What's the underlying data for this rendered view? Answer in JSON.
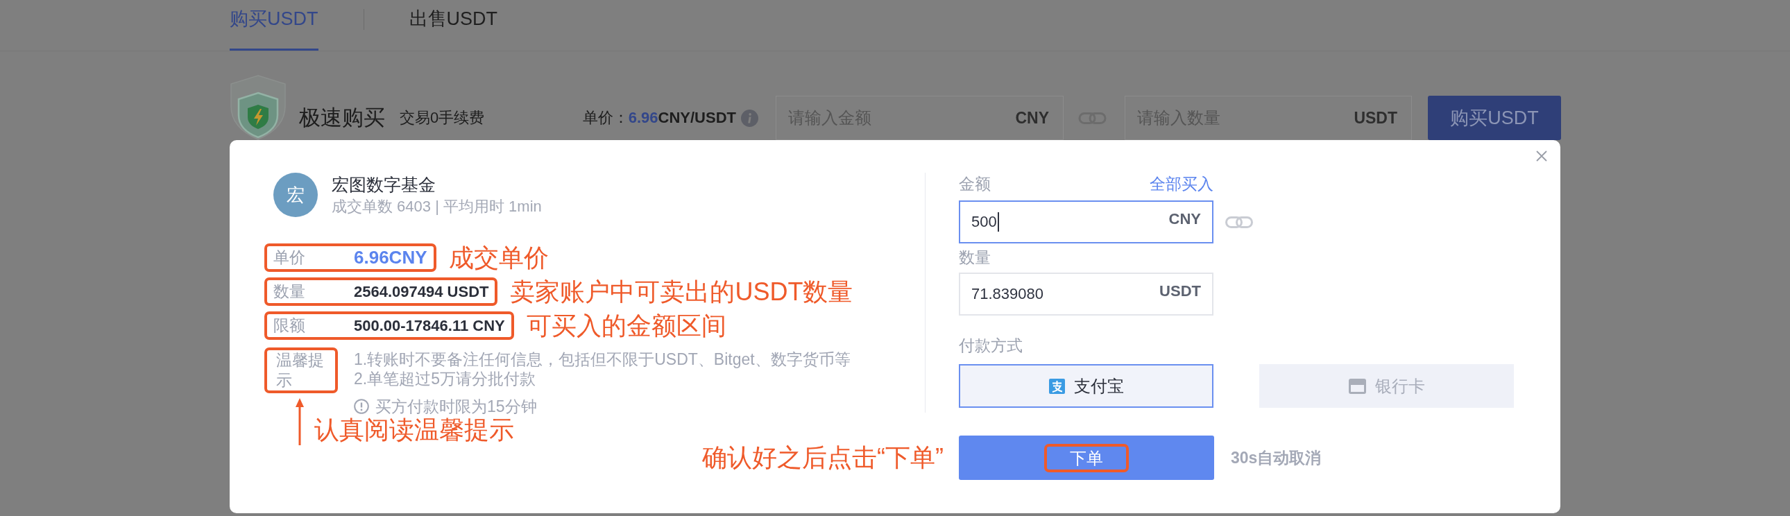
{
  "tabs": [
    {
      "label": "购买USDT",
      "selected": true
    },
    {
      "label": "出售USDT",
      "selected": false
    }
  ],
  "quick_buy": {
    "title": "极速购买",
    "subtitle": "交易0手续费",
    "price_label": "单价：",
    "price_value": "6.96",
    "price_unit": "CNY/USDT",
    "amount_field": {
      "placeholder": "请输入金额",
      "suffix": "CNY"
    },
    "quantity_field": {
      "placeholder": "请输入数量",
      "suffix": "USDT"
    },
    "button": "购买USDT"
  },
  "dialog": {
    "merchant": {
      "avatar": "宏",
      "name": "宏图数字基金",
      "stats": "成交单数 6403 | 平均用时 1min"
    },
    "details": [
      {
        "label": "单价",
        "value": "6.96CNY",
        "kind": "price",
        "highlighted": true,
        "note": "成交单价"
      },
      {
        "label": "数量",
        "value": "2564.097494 USDT",
        "kind": "amount",
        "highlighted": true,
        "note": "卖家账户中可卖出的USDT数量"
      },
      {
        "label": "限额",
        "value": "500.00-17846.11 CNY",
        "kind": "amount",
        "highlighted": true,
        "note": "可买入的金额区间"
      }
    ],
    "tips": {
      "label": "温馨提示",
      "highlighted": true,
      "note": "认真阅读温馨提示",
      "lines": [
        "1.转账时不要备注任何信息，包括但不限于USDT、Bitget、数字货币等",
        "2.单笔超过5万请分批付款"
      ],
      "notice": "买方付款时限为15分钟"
    },
    "form": {
      "amount": {
        "label": "金额",
        "action": "全部买入",
        "value": "500",
        "suffix": "CNY",
        "focused": true
      },
      "quantity": {
        "label": "数量",
        "value": "71.839080",
        "suffix": "USDT",
        "focused": false
      },
      "payment": {
        "label": "付款方式",
        "methods": [
          {
            "label": "支付宝",
            "kind": "alipay",
            "selected": true
          },
          {
            "label": "银行卡",
            "kind": "bank_card",
            "selected": false
          }
        ]
      },
      "submit": {
        "label": "下单",
        "highlighted": true,
        "note": "确认好之后点击“下单”"
      },
      "countdown": "30s自动取消"
    }
  }
}
